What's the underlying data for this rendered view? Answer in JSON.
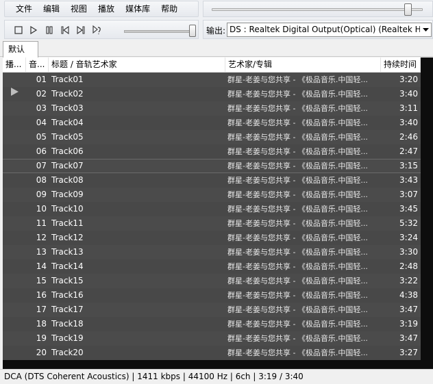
{
  "menu": {
    "items": [
      {
        "label": "文件"
      },
      {
        "label": "编辑"
      },
      {
        "label": "视图"
      },
      {
        "label": "播放"
      },
      {
        "label": "媒体库"
      },
      {
        "label": "帮助"
      }
    ]
  },
  "seekbar": {
    "position_fraction": 0.93
  },
  "controls": {
    "buttons": [
      {
        "name": "stop-icon"
      },
      {
        "name": "play-icon"
      },
      {
        "name": "pause-icon"
      },
      {
        "name": "previous-icon"
      },
      {
        "name": "next-icon"
      },
      {
        "name": "random-icon"
      }
    ],
    "volume_fraction": 0.98
  },
  "output": {
    "label": "输出:",
    "selected": "DS : Realtek Digital Output(Optical) (Realtek Hig"
  },
  "tabs": [
    {
      "label": "默认"
    }
  ],
  "playlist": {
    "columns": {
      "playing": "播...",
      "number": "音...",
      "title": "标题 / 音轨艺术家",
      "artist": "艺术家/专辑",
      "duration": "持续时间"
    },
    "rows": [
      {
        "num": "01",
        "title": "Track01",
        "artist": "群星-老姜与您共享 - 《极品音乐.中国轻...",
        "duration": "3:20",
        "playing": false,
        "selected": false
      },
      {
        "num": "02",
        "title": "Track02",
        "artist": "群星-老姜与您共享 - 《极品音乐.中国轻...",
        "duration": "3:40",
        "playing": true,
        "selected": false
      },
      {
        "num": "03",
        "title": "Track03",
        "artist": "群星-老姜与您共享 - 《极品音乐.中国轻...",
        "duration": "3:11",
        "playing": false,
        "selected": false
      },
      {
        "num": "04",
        "title": "Track04",
        "artist": "群星-老姜与您共享 - 《极品音乐.中国轻...",
        "duration": "3:40",
        "playing": false,
        "selected": false
      },
      {
        "num": "05",
        "title": "Track05",
        "artist": "群星-老姜与您共享 - 《极品音乐.中国轻...",
        "duration": "2:46",
        "playing": false,
        "selected": false
      },
      {
        "num": "06",
        "title": "Track06",
        "artist": "群星-老姜与您共享 - 《极品音乐.中国轻...",
        "duration": "2:47",
        "playing": false,
        "selected": false
      },
      {
        "num": "07",
        "title": "Track07",
        "artist": "群星-老姜与您共享 - 《极品音乐.中国轻...",
        "duration": "3:15",
        "playing": false,
        "selected": true
      },
      {
        "num": "08",
        "title": "Track08",
        "artist": "群星-老姜与您共享 - 《极品音乐.中国轻...",
        "duration": "3:43",
        "playing": false,
        "selected": false
      },
      {
        "num": "09",
        "title": "Track09",
        "artist": "群星-老姜与您共享 - 《极品音乐.中国轻...",
        "duration": "3:07",
        "playing": false,
        "selected": false
      },
      {
        "num": "10",
        "title": "Track10",
        "artist": "群星-老姜与您共享 - 《极品音乐.中国轻...",
        "duration": "3:45",
        "playing": false,
        "selected": false
      },
      {
        "num": "11",
        "title": "Track11",
        "artist": "群星-老姜与您共享 - 《极品音乐.中国轻...",
        "duration": "5:32",
        "playing": false,
        "selected": false
      },
      {
        "num": "12",
        "title": "Track12",
        "artist": "群星-老姜与您共享 - 《极品音乐.中国轻...",
        "duration": "3:24",
        "playing": false,
        "selected": false
      },
      {
        "num": "13",
        "title": "Track13",
        "artist": "群星-老姜与您共享 - 《极品音乐.中国轻...",
        "duration": "3:30",
        "playing": false,
        "selected": false
      },
      {
        "num": "14",
        "title": "Track14",
        "artist": "群星-老姜与您共享 - 《极品音乐.中国轻...",
        "duration": "2:48",
        "playing": false,
        "selected": false
      },
      {
        "num": "15",
        "title": "Track15",
        "artist": "群星-老姜与您共享 - 《极品音乐.中国轻...",
        "duration": "3:22",
        "playing": false,
        "selected": false
      },
      {
        "num": "16",
        "title": "Track16",
        "artist": "群星-老姜与您共享 - 《极品音乐.中国轻...",
        "duration": "4:38",
        "playing": false,
        "selected": false
      },
      {
        "num": "17",
        "title": "Track17",
        "artist": "群星-老姜与您共享 - 《极品音乐.中国轻...",
        "duration": "3:47",
        "playing": false,
        "selected": false
      },
      {
        "num": "18",
        "title": "Track18",
        "artist": "群星-老姜与您共享 - 《极品音乐.中国轻...",
        "duration": "3:19",
        "playing": false,
        "selected": false
      },
      {
        "num": "19",
        "title": "Track19",
        "artist": "群星-老姜与您共享 - 《极品音乐.中国轻...",
        "duration": "3:47",
        "playing": false,
        "selected": false
      },
      {
        "num": "20",
        "title": "Track20",
        "artist": "群星-老姜与您共享 - 《极品音乐.中国轻...",
        "duration": "3:27",
        "playing": false,
        "selected": false
      }
    ]
  },
  "status": {
    "text": "DCA (DTS Coherent Acoustics) | 1411 kbps | 44100 Hz | 6ch | 3:19 / 3:40"
  }
}
